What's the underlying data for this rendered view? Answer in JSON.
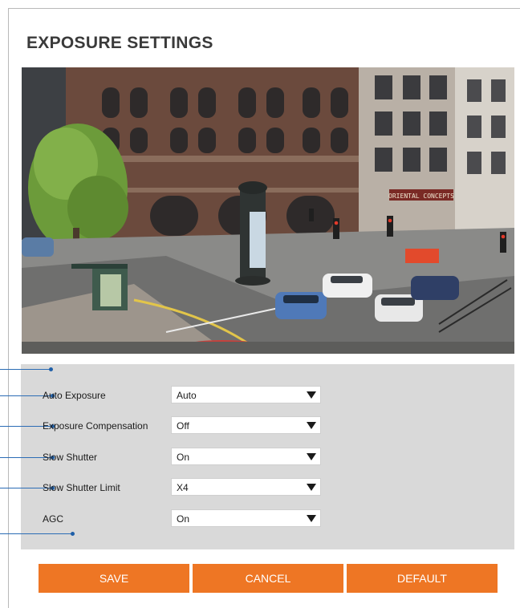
{
  "page": {
    "title": "EXPOSURE SETTINGS"
  },
  "settings": [
    {
      "label": "Auto Exposure",
      "value": "Auto"
    },
    {
      "label": "Exposure Compensation",
      "value": "Off"
    },
    {
      "label": "Slow Shutter",
      "value": "On"
    },
    {
      "label": "Slow Shutter Limit",
      "value": "X4"
    },
    {
      "label": "AGC",
      "value": "On"
    }
  ],
  "preview": {
    "storefront_sign": "ORIENTAL CONCEPTS"
  },
  "buttons": {
    "save": "SAVE",
    "cancel": "CANCEL",
    "default": "DEFAULT"
  },
  "colors": {
    "accent": "#ee7624",
    "panel": "#d9d9d9",
    "callout": "#2b6cb5"
  },
  "icons": {
    "dropdown": "chevron-down-icon"
  }
}
